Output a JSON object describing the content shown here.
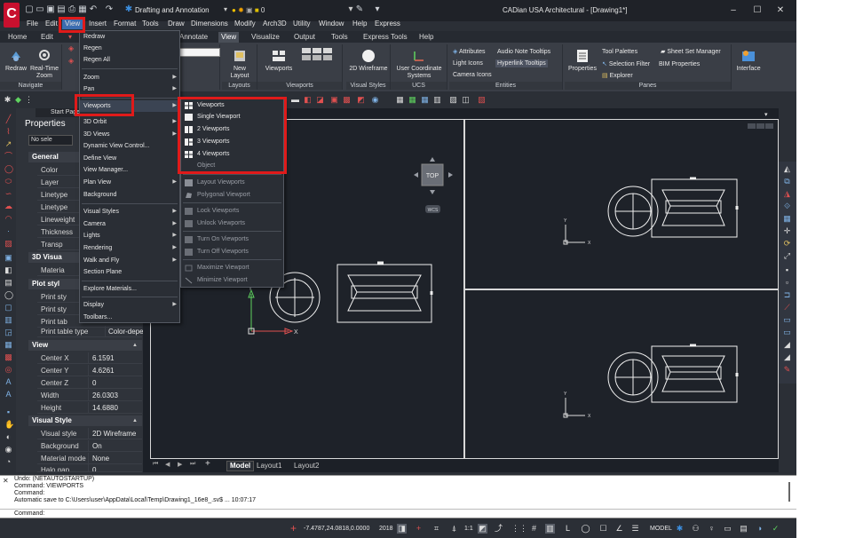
{
  "titlebar": {
    "workspace": "Drafting and Annotation",
    "layer": "0",
    "window_title": "CADian USA Architectural - [Drawing1*]"
  },
  "menubar": {
    "items": [
      "File",
      "Edit",
      "View",
      "Insert",
      "Format",
      "Tools",
      "Draw",
      "Dimensions",
      "Modify",
      "Arch3D",
      "Utility",
      "Window",
      "Help",
      "Express"
    ]
  },
  "ribbon": {
    "tabs": [
      "Home",
      "Edit",
      "Annotate",
      "View",
      "Visualize",
      "Output",
      "Tools",
      "Express Tools",
      "Help"
    ],
    "active_tab": "View",
    "panels": {
      "navigate": {
        "label": "Navigate",
        "redraw": "Redraw",
        "realtime": "Real-Time Zoom"
      },
      "layouts": {
        "label": "Layouts",
        "new_layout": "New Layout"
      },
      "viewports": {
        "label": "Viewports",
        "viewports_btn": "Viewports"
      },
      "visual_styles": {
        "label": "Visual Styles",
        "wireframe": "2D Wireframe"
      },
      "ucs": {
        "label": "UCS",
        "user_coord": "User Coordinate Systems"
      },
      "entities": {
        "label": "Entities",
        "attributes": "Attributes",
        "audio_note": "Audio Note Tooltips",
        "light_icons": "Light Icons",
        "hyperlink": "Hyperlink Tooltips",
        "camera_icons": "Camera Icons"
      },
      "panes": {
        "label": "Panes",
        "properties": "Properties",
        "tool_palettes": "Tool Palettes",
        "sheet_set": "Sheet Set Manager",
        "selection_filter": "Selection Filter",
        "bim_properties": "BIM Properties",
        "explorer": "Explorer"
      },
      "interface": {
        "label": "Interface"
      }
    }
  },
  "start_tab": "Start Page",
  "properties": {
    "title": "Properties",
    "selection": "No sele",
    "general": {
      "header": "General",
      "rows": [
        "Color",
        "Layer",
        "Linetype",
        "Linetype",
        "Lineweight",
        "Thickness",
        "Transp"
      ]
    },
    "visualization": {
      "header": "3D Visua",
      "rows": [
        "Materia"
      ]
    },
    "plot_style": {
      "header": "Plot styl",
      "rows": [
        "Print sty",
        "Print sty",
        "Print tab"
      ],
      "print_table_type": {
        "key": "Print table type",
        "value": "Color-depen..."
      }
    },
    "view": {
      "header": "View",
      "rows": [
        {
          "key": "Center X",
          "value": "6.1591"
        },
        {
          "key": "Center Y",
          "value": "4.6261"
        },
        {
          "key": "Center Z",
          "value": "0"
        },
        {
          "key": "Width",
          "value": "26.0303"
        },
        {
          "key": "Height",
          "value": "14.6880"
        }
      ]
    },
    "visual_style": {
      "header": "Visual Style",
      "rows": [
        {
          "key": "Visual style",
          "value": "2D Wireframe"
        },
        {
          "key": "Background",
          "value": "On"
        },
        {
          "key": "Material mode",
          "value": "None"
        },
        {
          "key": "Halo gap",
          "value": "0"
        }
      ]
    }
  },
  "view_menu": {
    "items": [
      {
        "label": "Redraw",
        "arrow": false
      },
      {
        "label": "Regen",
        "arrow": false
      },
      {
        "label": "Regen All",
        "arrow": false
      },
      {
        "label": "Zoom",
        "arrow": true
      },
      {
        "label": "Pan",
        "arrow": true
      },
      {
        "label": "Viewports",
        "arrow": true
      },
      {
        "label": "3D Orbit",
        "arrow": true
      },
      {
        "label": "3D Views",
        "arrow": true
      },
      {
        "label": "Dynamic View Control...",
        "arrow": false
      },
      {
        "label": "Define View",
        "arrow": false
      },
      {
        "label": "View Manager...",
        "arrow": false
      },
      {
        "label": "Plan View",
        "arrow": true
      },
      {
        "label": "Background",
        "arrow": false
      },
      {
        "label": "Visual Styles",
        "arrow": true
      },
      {
        "label": "Camera",
        "arrow": true
      },
      {
        "label": "Lights",
        "arrow": true
      },
      {
        "label": "Rendering",
        "arrow": true
      },
      {
        "label": "Walk and Fly",
        "arrow": true
      },
      {
        "label": "Section Plane",
        "arrow": false
      },
      {
        "label": "Explore Materials...",
        "arrow": false
      },
      {
        "label": "Display",
        "arrow": true
      },
      {
        "label": "Toolbars...",
        "arrow": false
      }
    ]
  },
  "viewports_submenu": {
    "items": [
      {
        "label": "Viewports",
        "enabled": true
      },
      {
        "label": "Single Viewport",
        "enabled": true
      },
      {
        "label": "2 Viewports",
        "enabled": true
      },
      {
        "label": "3 Viewports",
        "enabled": true
      },
      {
        "label": "4 Viewports",
        "enabled": true
      },
      {
        "label": "Object",
        "enabled": false
      },
      {
        "label": "Layout Viewports",
        "enabled": false
      },
      {
        "label": "Polygonal Viewport",
        "enabled": false
      },
      {
        "label": "Lock Viewports",
        "enabled": false
      },
      {
        "label": "Unlock Viewports",
        "enabled": false
      },
      {
        "label": "Turn On Viewports",
        "enabled": false
      },
      {
        "label": "Turn Off Viewports",
        "enabled": false
      },
      {
        "label": "Maximize Viewport",
        "enabled": false
      },
      {
        "label": "Minimize Viewport",
        "enabled": false
      }
    ]
  },
  "viewcube": {
    "face": "TOP",
    "wcs": "WCS"
  },
  "layout_tabs": [
    "Model",
    "Layout1",
    "Layout2"
  ],
  "command_history": [
    "Undo: (NETAUTOSTARTUP)",
    "Command: VIEWPORTS",
    "Command:",
    "Automatic save to C:\\Users\\user\\AppData\\Local\\Temp\\Drawing1_16e8_.sv$ ... 10:07:17"
  ],
  "command_prompt": "Command:",
  "statusbar": {
    "coords": "-7.4787,24.0818,0.0000",
    "year": "2018",
    "scale": "1:1",
    "space": "MODEL"
  },
  "colors": {
    "highlight_box": "#e01a1a",
    "menu_active": "#3b6cb0",
    "logo_red": "#c8102e"
  }
}
